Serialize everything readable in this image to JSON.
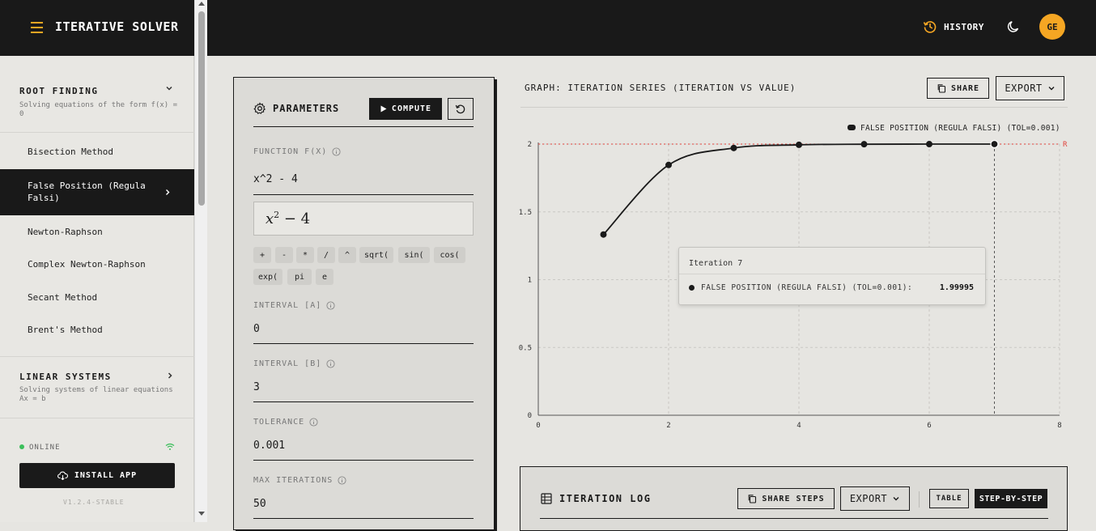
{
  "app": {
    "title": "ITERATIVE SOLVER"
  },
  "topbar": {
    "history_label": "HISTORY",
    "avatar_initials": "GE"
  },
  "sidebar": {
    "sections": [
      {
        "title": "ROOT FINDING",
        "subtitle": "Solving equations of the form f(x) = 0",
        "expanded": true
      },
      {
        "title": "LINEAR SYSTEMS",
        "subtitle": "Solving systems of linear equations Ax = b",
        "expanded": false
      }
    ],
    "items": [
      {
        "label": "Bisection Method"
      },
      {
        "label": "False Position (Regula Falsi)",
        "active": true
      },
      {
        "label": "Newton-Raphson"
      },
      {
        "label": "Complex Newton-Raphson"
      },
      {
        "label": "Secant Method"
      },
      {
        "label": "Brent's Method"
      }
    ],
    "status": "ONLINE",
    "install_label": "INSTALL APP",
    "version": "V1.2.4-STABLE"
  },
  "params": {
    "title": "PARAMETERS",
    "compute_label": "COMPUTE",
    "function_label": "FUNCTION F(X)",
    "function_value": "x^2 - 4",
    "latex_base": "x",
    "latex_exp": "2",
    "latex_rest": " − 4",
    "chips": [
      "+",
      "-",
      "*",
      "/",
      "^",
      "sqrt(",
      "sin(",
      "cos(",
      "exp(",
      "pi",
      "e"
    ],
    "interval_a_label": "INTERVAL [A]",
    "interval_a_value": "0",
    "interval_b_label": "INTERVAL [B]",
    "interval_b_value": "3",
    "tolerance_label": "TOLERANCE",
    "tolerance_value": "0.001",
    "max_iter_label": "MAX ITERATIONS",
    "max_iter_value": "50"
  },
  "graph": {
    "title": "GRAPH: ITERATION SERIES (ITERATION VS VALUE)",
    "share_label": "SHARE",
    "export_label": "EXPORT",
    "tooltip": {
      "heading": "Iteration 7",
      "series": "FALSE POSITION (REGULA FALSI) (TOL=0.001):",
      "value": "1.99995"
    }
  },
  "chart_data": {
    "type": "line",
    "legend": "FALSE POSITION (REGULA FALSI) (TOL=0.001)",
    "legend_position": "top-right",
    "x": [
      1,
      2,
      3,
      4,
      5,
      6,
      7
    ],
    "y": [
      1.333,
      1.846,
      1.971,
      1.9945,
      1.999,
      1.9998,
      1.99995
    ],
    "xlim": [
      0,
      8
    ],
    "ylim": [
      0,
      2
    ],
    "xticks": [
      "0",
      "2",
      "4",
      "6",
      "8"
    ],
    "yticks": [
      "0",
      "0.5",
      "1",
      "1.5",
      "2"
    ],
    "reference_line": 2,
    "reference_label": "R",
    "active_x": 7,
    "grid": true,
    "colors": {
      "line": "#1a1a1a",
      "reference": "#e0413a"
    }
  },
  "log": {
    "title": "ITERATION LOG",
    "share_steps_label": "SHARE STEPS",
    "export_label": "EXPORT",
    "table_label": "TABLE",
    "step_label": "STEP-BY-STEP"
  }
}
